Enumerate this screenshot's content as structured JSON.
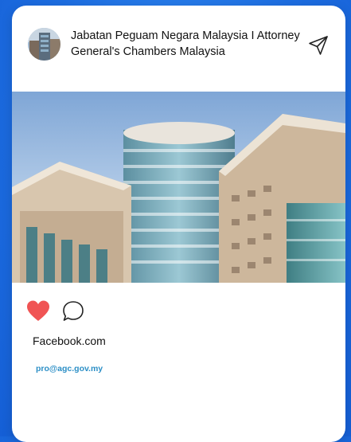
{
  "post": {
    "title": "Jabatan Peguam Negara Malaysia I Attorney General's Chambers Malaysia",
    "source": "Facebook.com",
    "email": "pro@agc.gov.my",
    "liked": true
  },
  "icons": {
    "avatar": "building-avatar",
    "share": "paper-plane-icon",
    "like": "heart-icon",
    "comment": "speech-bubble-icon"
  },
  "colors": {
    "background": "#1d6de0",
    "card": "#ffffff",
    "like": "#f05454",
    "email": "#2c8fc6"
  }
}
